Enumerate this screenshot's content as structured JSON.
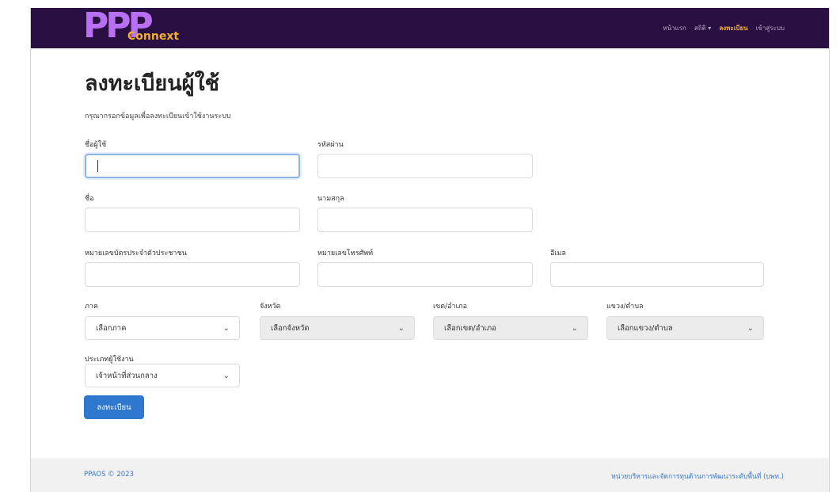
{
  "brand": {
    "logo_main": "PPP",
    "logo_sub": "Connext"
  },
  "nav": {
    "items": [
      {
        "label": "หน้าแรก",
        "active": false
      },
      {
        "label": "สถิติ ▾",
        "active": false
      },
      {
        "label": "ลงทะเบียน",
        "active": true
      },
      {
        "label": "เข้าสู่ระบบ",
        "active": false
      }
    ]
  },
  "page": {
    "title": "ลงทะเบียนผู้ใช้",
    "subtitle": "กรุณากรอกข้อมูลเพื่อลงทะเบียนเข้าใช้งานระบบ"
  },
  "form": {
    "username_label": "ชื่อผู้ใช้",
    "username_value": "",
    "password_label": "รหัสผ่าน",
    "password_value": "",
    "firstname_label": "ชื่อ",
    "firstname_value": "",
    "lastname_label": "นามสกุล",
    "lastname_value": "",
    "idcard_label": "หมายเลขบัตรประจำตัวประชาชน",
    "idcard_value": "",
    "phone_label": "หมายเลขโทรศัพท์",
    "phone_value": "",
    "email_label": "อีเมล",
    "email_value": "",
    "region_label": "ภาค",
    "region_selected": "เลือกภาค",
    "province_label": "จังหวัด",
    "province_selected": "เลือกจังหวัด",
    "district_label": "เขต/อำเภอ",
    "district_selected": "เลือกเขต/อำเภอ",
    "subdistrict_label": "แขวง/ตำบล",
    "subdistrict_selected": "เลือกแขวง/ตำบล",
    "usertype_label": "ประเภทผู้ใช้งาน",
    "usertype_selected": "เจ้าหน้าที่ส่วนกลาง",
    "submit_label": "ลงทะเบียน"
  },
  "footer": {
    "copyright": "PPAOS © 2023",
    "org": "หน่วยบริหารและจัดการทุนด้านการพัฒนาระดับพื้นที่ (บพท.)"
  },
  "icons": {
    "select_arrow": "chevron-down-icon"
  },
  "colors": {
    "navbar": "#2a0f42",
    "logo_ppp": "#b96ff2",
    "logo_connext": "#f2b02c",
    "nav_active": "#f2b02c",
    "primary_button": "#2f78cf",
    "footer_link": "#3a78c9"
  }
}
